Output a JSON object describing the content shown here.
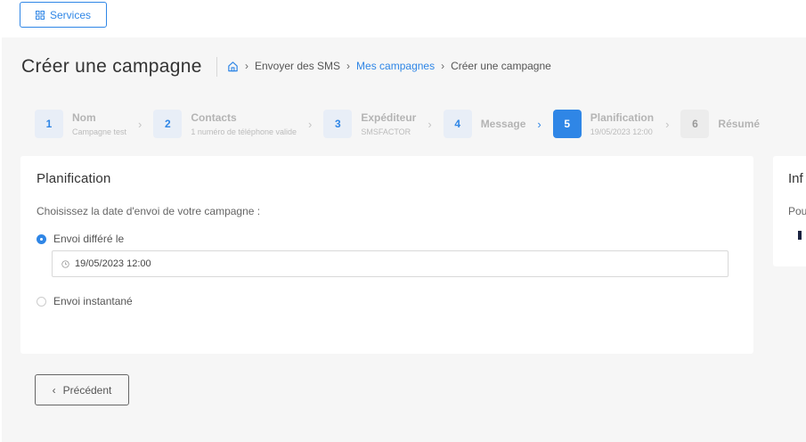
{
  "topbar": {
    "services_label": "Services"
  },
  "header": {
    "title": "Créer une campagne",
    "breadcrumb": [
      "Envoyer des SMS",
      "Mes campagnes",
      "Créer une campagne"
    ]
  },
  "stepper": [
    {
      "num": "1",
      "label": "Nom",
      "sub": "Campagne test"
    },
    {
      "num": "2",
      "label": "Contacts",
      "sub": "1 numéro de téléphone valide"
    },
    {
      "num": "3",
      "label": "Expéditeur",
      "sub": "SMSFACTOR"
    },
    {
      "num": "4",
      "label": "Message",
      "sub": ""
    },
    {
      "num": "5",
      "label": "Planification",
      "sub": "19/05/2023 12:00"
    },
    {
      "num": "6",
      "label": "Résumé",
      "sub": ""
    }
  ],
  "planning": {
    "title": "Planification",
    "description": "Choisissez la date d'envoi de votre campagne :",
    "option_deferred": "Envoi différé le",
    "date_value": "19/05/2023 12:00",
    "option_instant": "Envoi instantané"
  },
  "side": {
    "title": "Inf",
    "text": "Pou"
  },
  "footer": {
    "prev_label": "Précédent"
  },
  "colors": {
    "accent": "#2f86e6"
  }
}
